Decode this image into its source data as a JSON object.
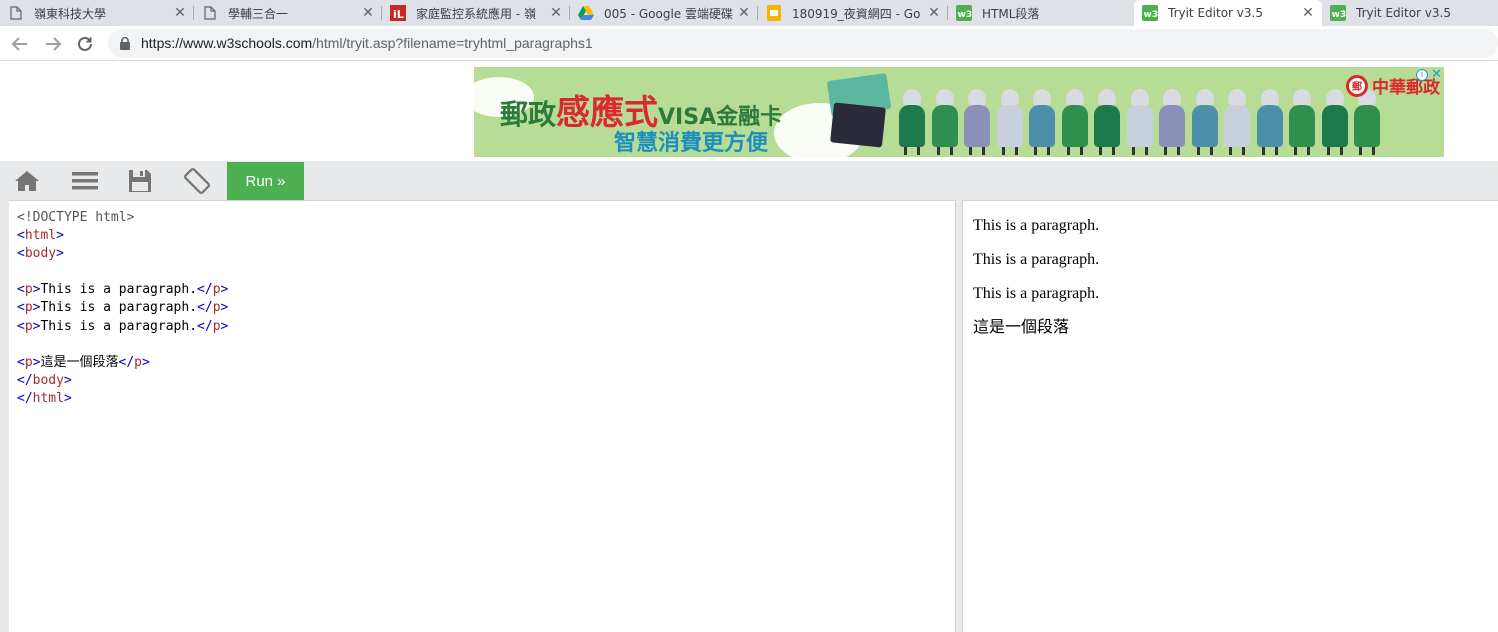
{
  "browser": {
    "tabs": [
      {
        "title": "嶺東科技大學",
        "icon": "page-icon"
      },
      {
        "title": "學輔三合一",
        "icon": "page-icon"
      },
      {
        "title": "家庭監控系統應用 - 嶺",
        "icon": "il-icon"
      },
      {
        "title": "005 - Google 雲端硬碟",
        "icon": "drive-icon"
      },
      {
        "title": "180919_夜資網四 - Go",
        "icon": "slides-icon"
      },
      {
        "title": "HTML段落",
        "icon": "w3-icon"
      },
      {
        "title": "Tryit Editor v3.5",
        "icon": "w3-icon",
        "active": true
      },
      {
        "title": "Tryit Editor v3.5",
        "icon": "w3-icon"
      }
    ],
    "url_host": "https://www.w3schools.com",
    "url_path": "/html/tryit.asp?filename=tryhtml_paragraphs1"
  },
  "ad": {
    "line1_a": "郵政",
    "line1_b": "感應式",
    "line1_c": "VISA金融卡",
    "line2": "智慧消費更方便",
    "brand": "中華郵政",
    "colors": {
      "bg": "#b7dc96",
      "green": "#2c7a3c",
      "red": "#d92b2b",
      "blue": "#1c8fbd"
    }
  },
  "editor": {
    "run_label": "Run »",
    "buttons": [
      "home-icon",
      "menu-icon",
      "save-icon",
      "rotate-icon"
    ],
    "accent": "#4caf50",
    "code_lines": [
      "<!DOCTYPE html>",
      "<html>",
      "<body>",
      "",
      "<p>This is a paragraph.</p>",
      "<p>This is a paragraph.</p>",
      "<p>This is a paragraph.</p>",
      "",
      "<p>這是一個段落</p>",
      "</body>",
      "</html>"
    ]
  },
  "result": {
    "paragraphs": [
      "This is a paragraph.",
      "This is a paragraph.",
      "This is a paragraph.",
      "這是一個段落"
    ]
  }
}
